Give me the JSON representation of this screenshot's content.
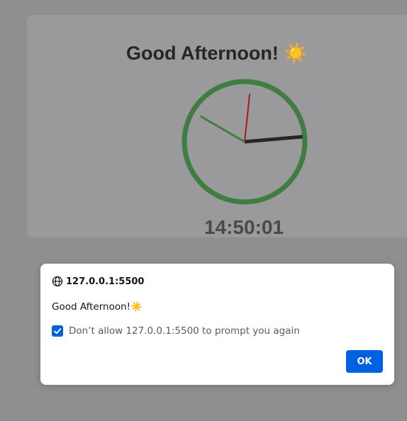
{
  "greeting": {
    "text": "Good Afternoon!",
    "emoji": "☀️"
  },
  "clock": {
    "time": "14:50:01",
    "hours": 14,
    "minutes": 50,
    "seconds": 1,
    "ring_color": "#3f7d43",
    "hour_hand_color": "#262628",
    "minute_hand_color": "#3f7d43",
    "second_hand_color": "#b01717"
  },
  "dialog": {
    "origin": "127.0.0.1:5500",
    "message": "Good Afternoon!",
    "message_emoji": "☀️",
    "checkbox_label": "Don’t allow 127.0.0.1:5500 to prompt you again",
    "checkbox_checked": true,
    "ok_label": "OK",
    "accent": "#0061e0"
  },
  "icons": {
    "origin": "globe-icon",
    "checkbox": "checkmark-icon"
  }
}
